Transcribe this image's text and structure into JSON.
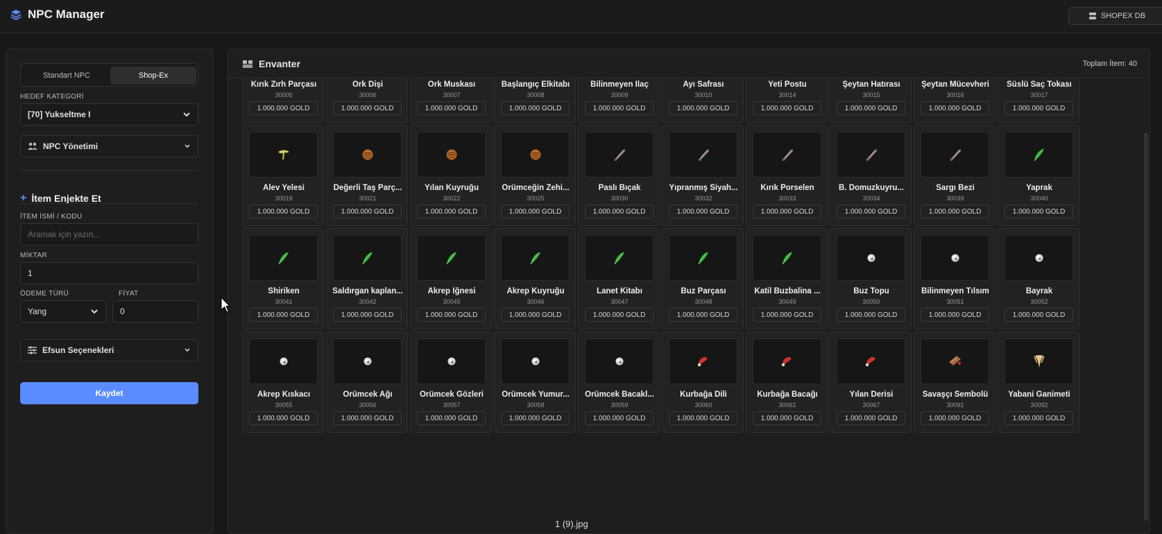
{
  "app": {
    "title": "NPC Manager",
    "db_button": "SHOPEX DB"
  },
  "sidebar": {
    "tabs": [
      "Standart NPC",
      "Shop-Ex"
    ],
    "category_label": "HEDEF KATEGORİ",
    "category_value": "[70] Yukseltme I",
    "npc_accordion": "NPC Yönetimi",
    "inject_title": "İtem Enjekte Et",
    "item_label": "İTEM İSMİ / KODU",
    "item_placeholder": "Aramak için yazın...",
    "qty_label": "MİKTAR",
    "qty_value": "1",
    "pay_label": "ÖDEME TÜRÜ",
    "pay_value": "Yang",
    "price_label": "FİYAT",
    "price_value": "0",
    "efsun_accordion": "Efsun Seçenekleri",
    "save": "Kaydet"
  },
  "inventory": {
    "title": "Envanter",
    "total": "Toplam İtem: 40",
    "price_text": "1.000.000 GOLD",
    "items": [
      {
        "name": "Kırık Zırh Parçası",
        "code": "30005",
        "icon": "none"
      },
      {
        "name": "Ork Dişi",
        "code": "30006",
        "icon": "none"
      },
      {
        "name": "Ork Muskası",
        "code": "30007",
        "icon": "none"
      },
      {
        "name": "Başlangıç Elkitabı",
        "code": "30008",
        "icon": "none"
      },
      {
        "name": "Bilinmeyen İlaç",
        "code": "30009",
        "icon": "none"
      },
      {
        "name": "Ayı Safrası",
        "code": "30010",
        "icon": "none"
      },
      {
        "name": "Yeti Postu",
        "code": "30014",
        "icon": "none"
      },
      {
        "name": "Şeytan Hatırası",
        "code": "30015",
        "icon": "none"
      },
      {
        "name": "Şeytan Mücevheri",
        "code": "30016",
        "icon": "none"
      },
      {
        "name": "Süslü Saç Tokası",
        "code": "30017",
        "icon": "none"
      },
      {
        "name": "Alev Yelesi",
        "code": "30019",
        "icon": "flame-mane"
      },
      {
        "name": "Değerli Taş Parç...",
        "code": "30021",
        "icon": "shell"
      },
      {
        "name": "Yılan Kuyruğu",
        "code": "30022",
        "icon": "shell"
      },
      {
        "name": "Örümceğin Zehi...",
        "code": "30025",
        "icon": "shell"
      },
      {
        "name": "Paslı Bıçak",
        "code": "30030",
        "icon": "blade"
      },
      {
        "name": "Yıpranmış Siyah...",
        "code": "30032",
        "icon": "blade"
      },
      {
        "name": "Kırık Porselen",
        "code": "30033",
        "icon": "blade"
      },
      {
        "name": "B. Domuzkuyru...",
        "code": "30034",
        "icon": "blade"
      },
      {
        "name": "Sargı Bezi",
        "code": "30039",
        "icon": "blade"
      },
      {
        "name": "Yaprak",
        "code": "30040",
        "icon": "leaf"
      },
      {
        "name": "Shiriken",
        "code": "30041",
        "icon": "leaf"
      },
      {
        "name": "Saldırgan kaplan...",
        "code": "30042",
        "icon": "leaf"
      },
      {
        "name": "Akrep İğnesi",
        "code": "30045",
        "icon": "leaf"
      },
      {
        "name": "Akrep Kuyruğu",
        "code": "30046",
        "icon": "leaf"
      },
      {
        "name": "Lanet Kitabı",
        "code": "30047",
        "icon": "leaf"
      },
      {
        "name": "Buz Parçası",
        "code": "30048",
        "icon": "leaf"
      },
      {
        "name": "Katil Buzbalina ...",
        "code": "30049",
        "icon": "leaf"
      },
      {
        "name": "Buz Topu",
        "code": "30050",
        "icon": "orb"
      },
      {
        "name": "Bilinmeyen Tılsım",
        "code": "30051",
        "icon": "orb"
      },
      {
        "name": "Bayrak",
        "code": "30052",
        "icon": "orb"
      },
      {
        "name": "Akrep Kıskacı",
        "code": "30055",
        "icon": "orb"
      },
      {
        "name": "Örümcek Ağı",
        "code": "30056",
        "icon": "orb"
      },
      {
        "name": "Örümcek Gözleri",
        "code": "30057",
        "icon": "orb"
      },
      {
        "name": "Örümcek Yumur...",
        "code": "30058",
        "icon": "orb"
      },
      {
        "name": "Örümcek Bacakl...",
        "code": "30059",
        "icon": "orb"
      },
      {
        "name": "Kurbağa Dili",
        "code": "30060",
        "icon": "meat"
      },
      {
        "name": "Kurbağa Bacağı",
        "code": "30061",
        "icon": "meat"
      },
      {
        "name": "Yılan Derisi",
        "code": "30067",
        "icon": "meat"
      },
      {
        "name": "Savaşçı Sembolü",
        "code": "30091",
        "icon": "symbol"
      },
      {
        "name": "Yabani Ganimeti",
        "code": "30092",
        "icon": "fang"
      }
    ]
  },
  "colors": {
    "accent": "#5b8cff",
    "bg": "#181818",
    "panel": "#1e1e1e"
  },
  "caption": "1 (9).jpg"
}
